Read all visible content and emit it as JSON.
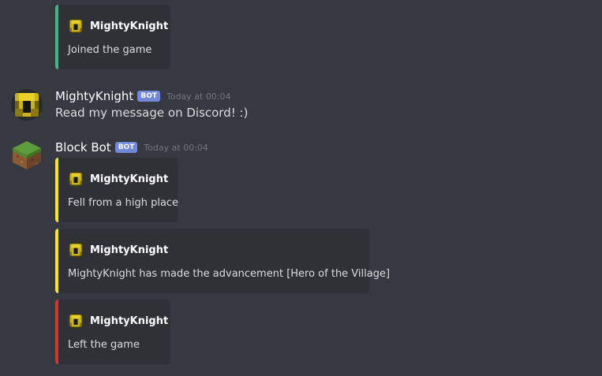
{
  "colors": {
    "background": "#36393f",
    "embed_bg": "#2f3136",
    "embed_join": "#43b581",
    "embed_death": "#f5e624",
    "embed_advancement": "#f5e624",
    "embed_leave": "#d1392c",
    "bot_tag": "#7289da"
  },
  "embeds_top": [
    {
      "author": "MightyKnight",
      "icon": "minecraft-head-icon",
      "description": "Joined the game"
    }
  ],
  "messages": [
    {
      "username": "MightyKnight",
      "bot_tag": "BOT",
      "timestamp": "Today at 00:04",
      "avatar_icon": "minecraft-head-icon",
      "content": "Read my message on Discord! :)"
    },
    {
      "username": "Block Bot",
      "bot_tag": "BOT",
      "timestamp": "Today at 00:04",
      "avatar_icon": "grass-block-icon",
      "embeds": [
        {
          "author": "MightyKnight",
          "icon": "minecraft-head-icon",
          "description": "Fell from a high place"
        },
        {
          "author": "MightyKnight",
          "icon": "minecraft-head-icon",
          "description": "MightyKnight has made the advancement [Hero of the Village]"
        },
        {
          "author": "MightyKnight",
          "icon": "minecraft-head-icon",
          "description": "Left the game"
        }
      ]
    }
  ]
}
